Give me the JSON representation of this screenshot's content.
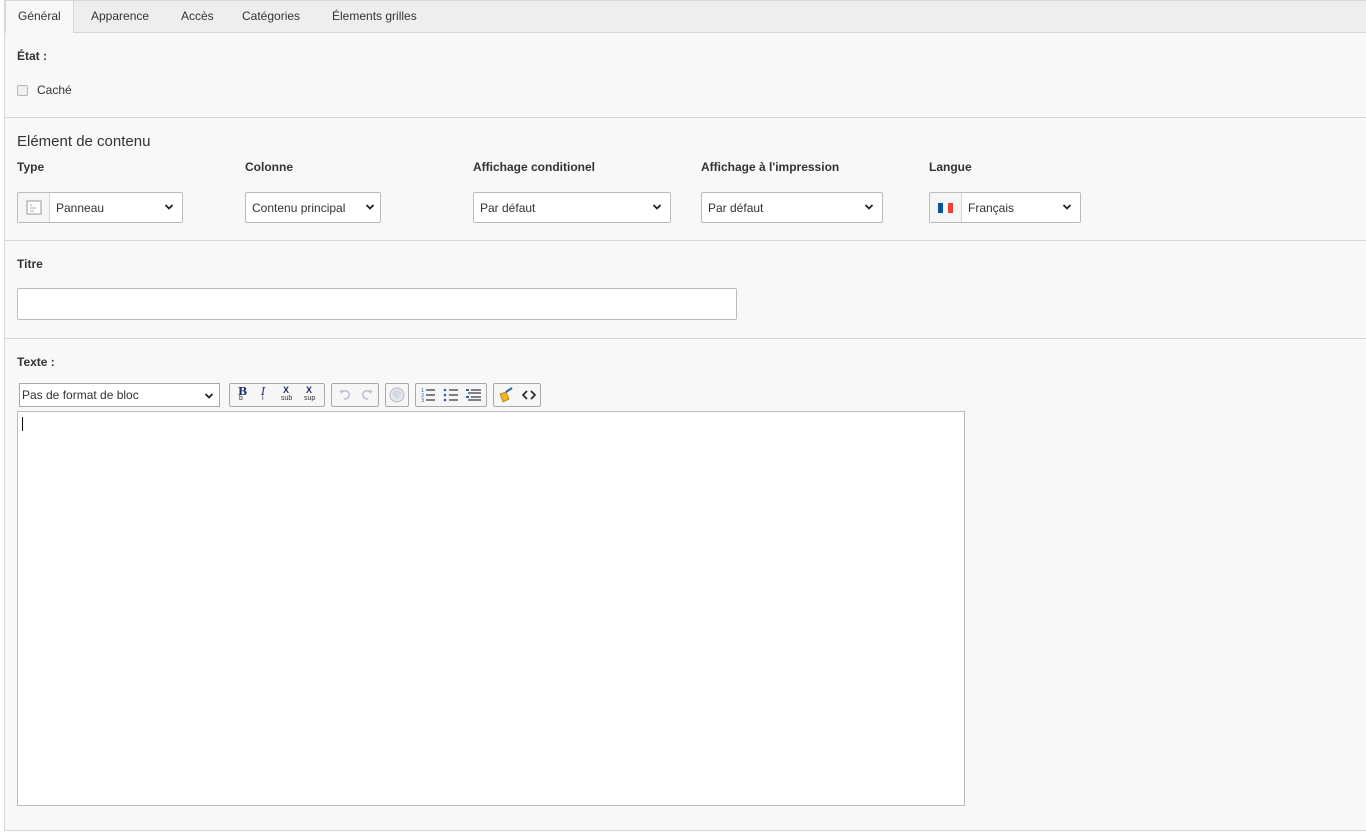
{
  "tabs": [
    {
      "label": "Général",
      "active": true
    },
    {
      "label": "Apparence",
      "active": false
    },
    {
      "label": "Accès",
      "active": false
    },
    {
      "label": "Catégories",
      "active": false
    },
    {
      "label": "Élements grilles",
      "active": false
    }
  ],
  "state": {
    "label": "État :",
    "hidden_checkbox_label": "Caché",
    "hidden_checked": false
  },
  "content_element": {
    "section_title": "Elément de contenu",
    "type": {
      "label": "Type",
      "value": "Panneau",
      "icon": "content-panel-icon"
    },
    "column": {
      "label": "Colonne",
      "value": "Contenu principal"
    },
    "conditional": {
      "label": "Affichage conditionel",
      "value": "Par défaut"
    },
    "print": {
      "label": "Affichage à l'impression",
      "value": "Par défaut"
    },
    "language": {
      "label": "Langue",
      "value": "Français",
      "icon": "flag-france-icon"
    }
  },
  "title": {
    "label": "Titre",
    "value": ""
  },
  "text": {
    "label": "Texte :",
    "block_format": "Pas de format de bloc",
    "toolbar": {
      "b_letter": "B",
      "b_sub": "b",
      "i_letter": "I",
      "i_sub": "i",
      "sub_letter": "X",
      "sub_label": "sub",
      "sup_letter": "X",
      "sup_label": "sup"
    },
    "content": ""
  },
  "colors": {
    "border": "#d7d7d7",
    "tab_bar": "#eeeeee",
    "background": "#f8f8f8",
    "flag_blue": "#0055a4",
    "flag_red": "#ef4135"
  }
}
